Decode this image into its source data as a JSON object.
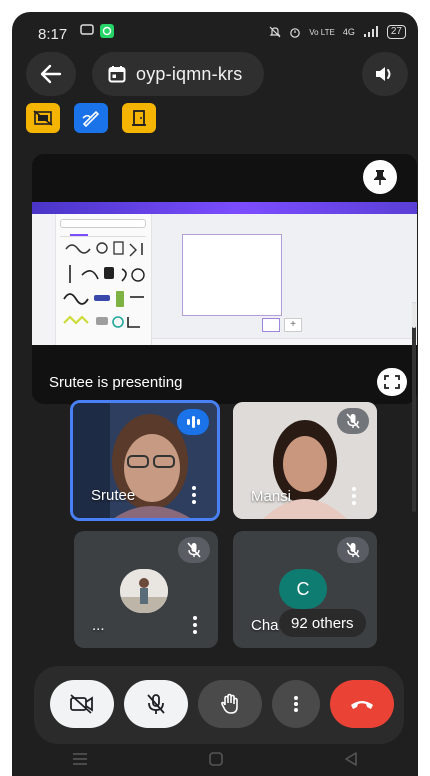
{
  "status_bar": {
    "time": "8:17",
    "network": "Vo LTE",
    "signal_text": "4G",
    "battery": "27"
  },
  "top_bar": {
    "meeting_code": "oyp-iqmn-krs",
    "back_icon": "arrow-left-icon",
    "calendar_icon": "calendar-icon",
    "speaker_icon": "speaker-icon"
  },
  "status_chips": [
    {
      "icon": "recording-off-icon",
      "color": "#f4b400"
    },
    {
      "icon": "whiteboard-icon",
      "color": "#1a73e8"
    },
    {
      "icon": "door-icon",
      "color": "#f4b400"
    }
  ],
  "presentation": {
    "presenter_label": "Srutee is presenting",
    "pin_icon": "pin-icon",
    "fullscreen_icon": "fullscreen-icon"
  },
  "tiles": [
    {
      "name": "Srutee",
      "state": "speaking"
    },
    {
      "name": "Mansi",
      "state": "muted"
    },
    {
      "name": "...",
      "state": "muted"
    },
    {
      "name": "Cha",
      "initial": "C",
      "others_label": "92 others",
      "state": "muted"
    }
  ],
  "controls": {
    "camera": "camera-off-icon",
    "mic": "mic-off-icon",
    "hand": "raise-hand-icon",
    "more": "more-icon",
    "end_call": "end-call-icon"
  },
  "colors": {
    "background": "#1f1f1f",
    "accent_blue": "#1a73e8",
    "end_call_red": "#ea4335",
    "avatar_teal": "#0f7c72"
  }
}
